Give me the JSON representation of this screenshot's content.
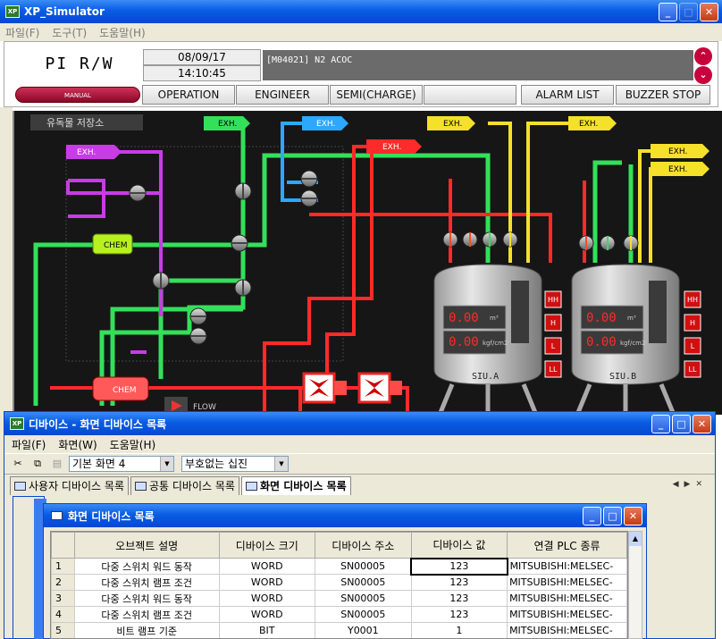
{
  "app": {
    "title": "XP_Simulator",
    "icon": "XP"
  },
  "menu": [
    "파일(F)",
    "도구(T)",
    "도움말(H)"
  ],
  "header": {
    "plc_label": "PI R/W",
    "mode_label": "MANUAL",
    "date": "08/09/17",
    "time": "14:10:45",
    "alarm_text": "[M04021] N2 ACOC",
    "buttons": [
      "OPERATION",
      "ENGINEER",
      "SEMI(CHARGE)",
      "",
      "ALARM LIST",
      "BUZZER STOP"
    ]
  },
  "diagram": {
    "area_label": "유독물 저장소",
    "exh_label": "EXH.",
    "chem_label": "CHEM",
    "flow_label": "FLOW",
    "tanks": [
      {
        "name": "SIU.A",
        "value1": "0.00",
        "unit1": "m³",
        "value2": "0.00",
        "unit2": "kgf/cm2",
        "levels": [
          "HH",
          "H",
          "L",
          "LL"
        ]
      },
      {
        "name": "SIU.B",
        "value1": "0.00",
        "unit1": "m³",
        "value2": "0.00",
        "unit2": "kgf/cm2",
        "levels": [
          "HH",
          "H",
          "L",
          "LL"
        ]
      }
    ],
    "colors": {
      "green": "#33e05a",
      "blue": "#2da8ff",
      "red": "#ff2a2a",
      "yellow": "#f5e02a",
      "purple": "#c83ce6",
      "lime": "#b8f020"
    }
  },
  "device_window": {
    "title": "디바이스 - 화면 디바이스 목록",
    "menu": [
      "파일(F)",
      "화면(W)",
      "도움말(H)"
    ],
    "screen_combo": "기본 화면 4",
    "format_combo": "부호없는 십진",
    "tabs": [
      "사용자 디바이스 목록",
      "공통 디바이스 목록",
      "화면 디바이스 목록"
    ]
  },
  "list_window": {
    "title": "화면 디바이스 목록",
    "columns": [
      "오브젝트 설명",
      "디바이스 크기",
      "디바이스 주소",
      "디바이스 값",
      "연결 PLC 종류"
    ],
    "rows": [
      {
        "no": "1",
        "desc": "다중 스위치 워드 동작",
        "size": "WORD",
        "addr": "SN00005",
        "value": "123",
        "plc": "MITSUBISHI:MELSEC-"
      },
      {
        "no": "2",
        "desc": "다중 스위치 램프 조건",
        "size": "WORD",
        "addr": "SN00005",
        "value": "123",
        "plc": "MITSUBISHI:MELSEC-"
      },
      {
        "no": "3",
        "desc": "다중 스위치 워드 동작",
        "size": "WORD",
        "addr": "SN00005",
        "value": "123",
        "plc": "MITSUBISHI:MELSEC-"
      },
      {
        "no": "4",
        "desc": "다중 스위치 램프 조건",
        "size": "WORD",
        "addr": "SN00005",
        "value": "123",
        "plc": "MITSUBISHI:MELSEC-"
      },
      {
        "no": "5",
        "desc": "비트 램프 기준",
        "size": "BIT",
        "addr": "Y0001",
        "value": "1",
        "plc": "MITSUBISHI:MELSEC-"
      }
    ]
  }
}
